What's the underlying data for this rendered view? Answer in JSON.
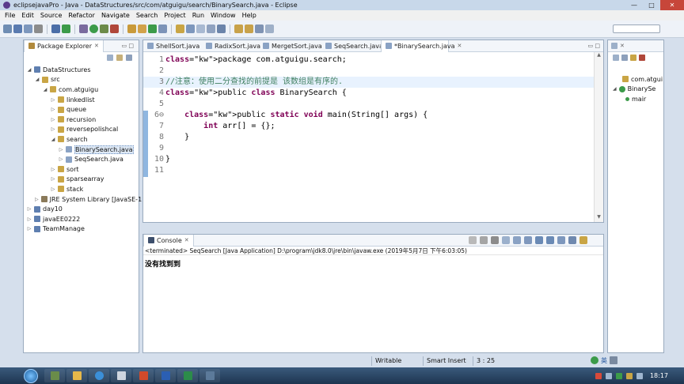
{
  "window": {
    "title": "eclipsejavaPro - Java - DataStructures/src/com/atguigu/search/BinarySearch.java - Eclipse"
  },
  "menu": [
    "File",
    "Edit",
    "Source",
    "Refactor",
    "Navigate",
    "Search",
    "Project",
    "Run",
    "Window",
    "Help"
  ],
  "package_explorer": {
    "tab_label": "Package Explorer",
    "tree": [
      {
        "label": "DataStructures",
        "arrow": "◢",
        "kind": "project"
      },
      {
        "label": "src",
        "arrow": "◢",
        "kind": "srcfolder"
      },
      {
        "label": "com.atguigu",
        "arrow": "◢",
        "kind": "package"
      },
      {
        "label": "linkedlist",
        "arrow": "▷",
        "kind": "package"
      },
      {
        "label": "queue",
        "arrow": "▷",
        "kind": "package"
      },
      {
        "label": "recursion",
        "arrow": "▷",
        "kind": "package"
      },
      {
        "label": "reversepolishcal",
        "arrow": "▷",
        "kind": "package"
      },
      {
        "label": "search",
        "arrow": "◢",
        "kind": "package"
      },
      {
        "label": "BinarySearch.java",
        "arrow": "▷",
        "kind": "java"
      },
      {
        "label": "SeqSearch.java",
        "arrow": "▷",
        "kind": "java"
      },
      {
        "label": "sort",
        "arrow": "▷",
        "kind": "package"
      },
      {
        "label": "sparsearray",
        "arrow": "▷",
        "kind": "package"
      },
      {
        "label": "stack",
        "arrow": "▷",
        "kind": "package"
      },
      {
        "label": "JRE System Library [JavaSE-1",
        "arrow": "▷",
        "kind": "library"
      },
      {
        "label": "day10",
        "arrow": "▷",
        "kind": "project"
      },
      {
        "label": "javaEE0222",
        "arrow": "▷",
        "kind": "project"
      },
      {
        "label": "TeamManage",
        "arrow": "▷",
        "kind": "project"
      }
    ]
  },
  "editor": {
    "tabs": [
      {
        "label": "ShellSort.java",
        "active": false
      },
      {
        "label": "RadixSort.java",
        "active": false
      },
      {
        "label": "MergetSort.java",
        "active": false
      },
      {
        "label": "SeqSearch.java",
        "active": false
      },
      {
        "label": "*BinarySearch.java",
        "active": true
      }
    ],
    "lines": [
      {
        "n": "1",
        "text": "package com.atguigu.search;"
      },
      {
        "n": "2",
        "text": ""
      },
      {
        "n": "3",
        "text": "//注意：使用二分查找的前提是 该数组是有序的."
      },
      {
        "n": "4",
        "text": "public class BinarySearch {"
      },
      {
        "n": "5",
        "text": ""
      },
      {
        "n": "6⊖",
        "text": "    public static void main(String[] args) {"
      },
      {
        "n": "7",
        "text": "        int arr[] = {};"
      },
      {
        "n": "8",
        "text": "    }"
      },
      {
        "n": "9",
        "text": ""
      },
      {
        "n": "10",
        "text": "}"
      },
      {
        "n": "11",
        "text": ""
      }
    ]
  },
  "console": {
    "tab_label": "Console",
    "info": "<terminated> SeqSearch [Java Application] D:\\program\\jdk8.0\\jre\\bin\\javaw.exe (2019年5月7日 下午6:03:05)",
    "output": "没有找到到"
  },
  "outline": {
    "items": [
      {
        "label": "com.atgui",
        "kind": "package"
      },
      {
        "label": "BinarySe",
        "kind": "class"
      },
      {
        "label": "mair",
        "kind": "method"
      }
    ]
  },
  "status": {
    "writable": "Writable",
    "insert_mode": "Smart Insert",
    "position": "3 : 25"
  },
  "taskbar": {
    "clock": "18:17"
  },
  "colors": {
    "keyword": "#7f0055",
    "comment": "#3f7f5f",
    "current_line": "#e8f2fe"
  }
}
